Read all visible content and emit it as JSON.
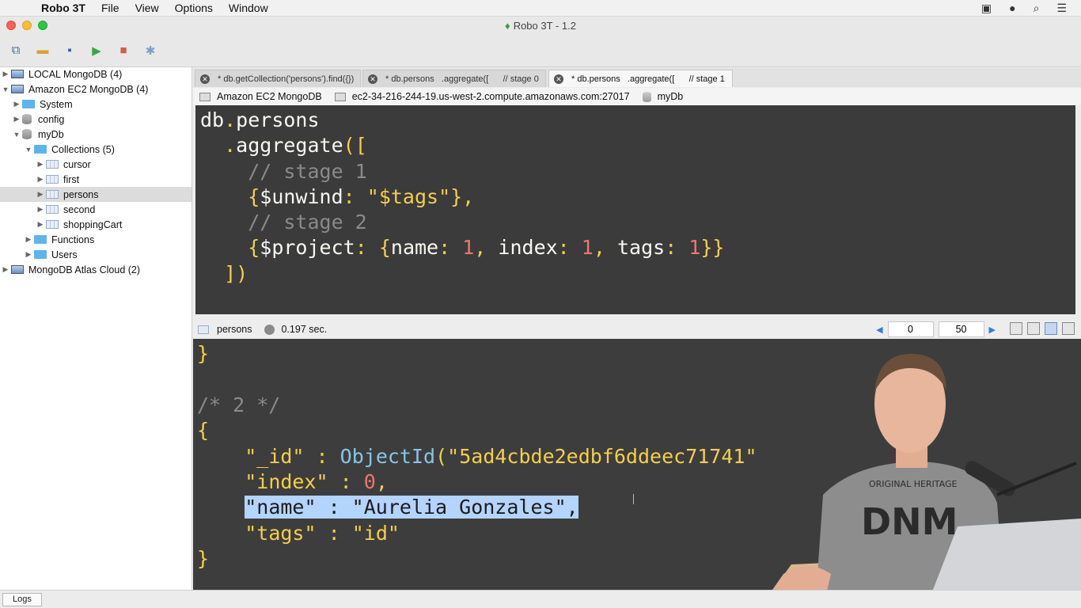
{
  "menubar": {
    "app_name": "Robo 3T",
    "items": [
      "File",
      "View",
      "Options",
      "Window"
    ]
  },
  "window": {
    "title": "Robo 3T - 1.2"
  },
  "tree": [
    {
      "label": "LOCAL MongoDB (4)",
      "icon": "server-icon",
      "expanded": false
    },
    {
      "label": "Amazon EC2 MongoDB (4)",
      "icon": "server-icon",
      "expanded": true
    },
    {
      "label": "System",
      "icon": "folder-icon"
    },
    {
      "label": "config",
      "icon": "database-icon"
    },
    {
      "label": "myDb",
      "icon": "database-icon",
      "expanded": true
    },
    {
      "label": "Collections (5)",
      "icon": "folder-icon",
      "expanded": true
    },
    {
      "label": "cursor",
      "icon": "collection-icon"
    },
    {
      "label": "first",
      "icon": "collection-icon"
    },
    {
      "label": "persons",
      "icon": "collection-icon",
      "selected": true
    },
    {
      "label": "second",
      "icon": "collection-icon"
    },
    {
      "label": "shoppingCart",
      "icon": "collection-icon"
    },
    {
      "label": "Functions",
      "icon": "folder-icon"
    },
    {
      "label": "Users",
      "icon": "folder-icon"
    },
    {
      "label": "MongoDB Atlas Cloud (2)",
      "icon": "server-icon",
      "expanded": false
    }
  ],
  "tabs": [
    {
      "label": "* db.getCollection('persons').find({})",
      "active": false
    },
    {
      "label": "* db.persons   .aggregate([      // stage 0",
      "active": false
    },
    {
      "label": "* db.persons   .aggregate([      // stage 1",
      "active": true
    }
  ],
  "connection": {
    "server": "Amazon EC2 MongoDB",
    "host": "ec2-34-216-244-19.us-west-2.compute.amazonaws.com:27017",
    "database": "myDb"
  },
  "editor": {
    "code": "db.persons\n  .aggregate([\n    // stage 1\n    {$unwind: \"$tags\"},\n    // stage 2\n    {$project: {name: 1, index: 1, tags: 1}}\n  ])"
  },
  "results_toolbar": {
    "collection": "persons",
    "time": "0.197 sec.",
    "skip": "0",
    "limit": "50"
  },
  "results": {
    "doc_comment": "/* 2 */",
    "object_id": "5ad4cbde2edbf6ddeec71741",
    "index_value": "0",
    "name_value": "Aurelia Gonzales",
    "tags_value": "id"
  },
  "statusbar": {
    "logs_label": "Logs"
  },
  "colors": {
    "editor_bg": "#3b3b3b",
    "keyword_yellow": "#f5cf4a",
    "number_pink": "#f2756a",
    "comment_gray": "#8a8a8a",
    "selection": "#b3d4fc"
  }
}
